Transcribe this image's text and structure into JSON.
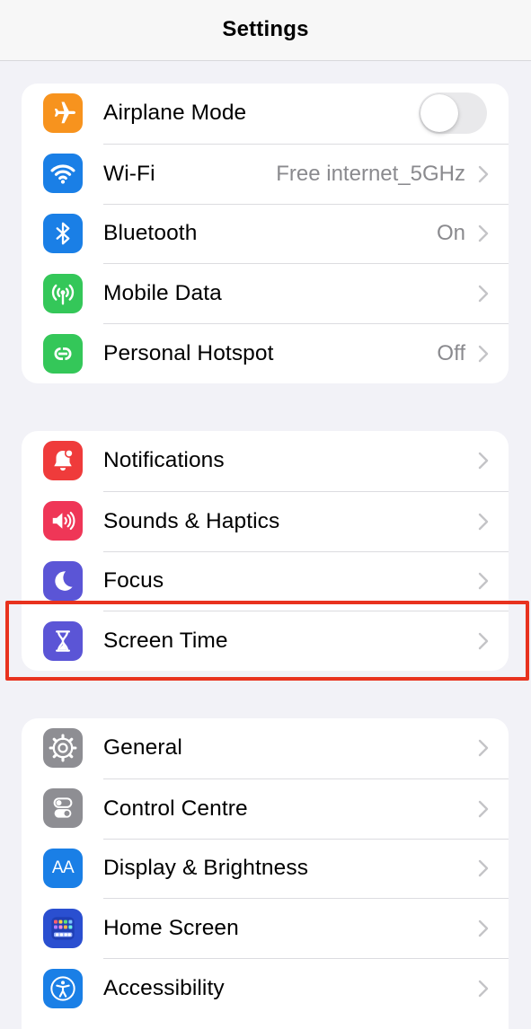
{
  "navbar": {
    "title": "Settings"
  },
  "group1": [
    {
      "label": "Airplane Mode",
      "icon": "airplane-icon",
      "color": "#f7931e",
      "toggle": false
    },
    {
      "label": "Wi-Fi",
      "icon": "wifi-icon",
      "color": "#1a7fe6",
      "value": "Free internet_5GHz"
    },
    {
      "label": "Bluetooth",
      "icon": "bluetooth-icon",
      "color": "#1a7fe6",
      "value": "On"
    },
    {
      "label": "Mobile Data",
      "icon": "antenna-icon",
      "color": "#34c759"
    },
    {
      "label": "Personal Hotspot",
      "icon": "hotspot-icon",
      "color": "#34c759",
      "value": "Off"
    }
  ],
  "group2": [
    {
      "label": "Notifications",
      "icon": "bell-icon",
      "color": "#ef3b3b"
    },
    {
      "label": "Sounds & Haptics",
      "icon": "speaker-icon",
      "color": "#ef3657"
    },
    {
      "label": "Focus",
      "icon": "moon-icon",
      "color": "#5b55d6"
    },
    {
      "label": "Screen Time",
      "icon": "hourglass-icon",
      "color": "#5b55d6"
    }
  ],
  "group3": [
    {
      "label": "General",
      "icon": "gear-icon",
      "color": "#8e8e93"
    },
    {
      "label": "Control Centre",
      "icon": "switches-icon",
      "color": "#8e8e93"
    },
    {
      "label": "Display & Brightness",
      "icon": "text-size-icon",
      "color": "#1a7fe6",
      "glyph": "AA"
    },
    {
      "label": "Home Screen",
      "icon": "home-grid-icon",
      "color": "#2a4fd0"
    },
    {
      "label": "Accessibility",
      "icon": "accessibility-icon",
      "color": "#1a7fe6"
    }
  ],
  "highlight": {
    "target": "Screen Time",
    "color": "#e8321e"
  }
}
